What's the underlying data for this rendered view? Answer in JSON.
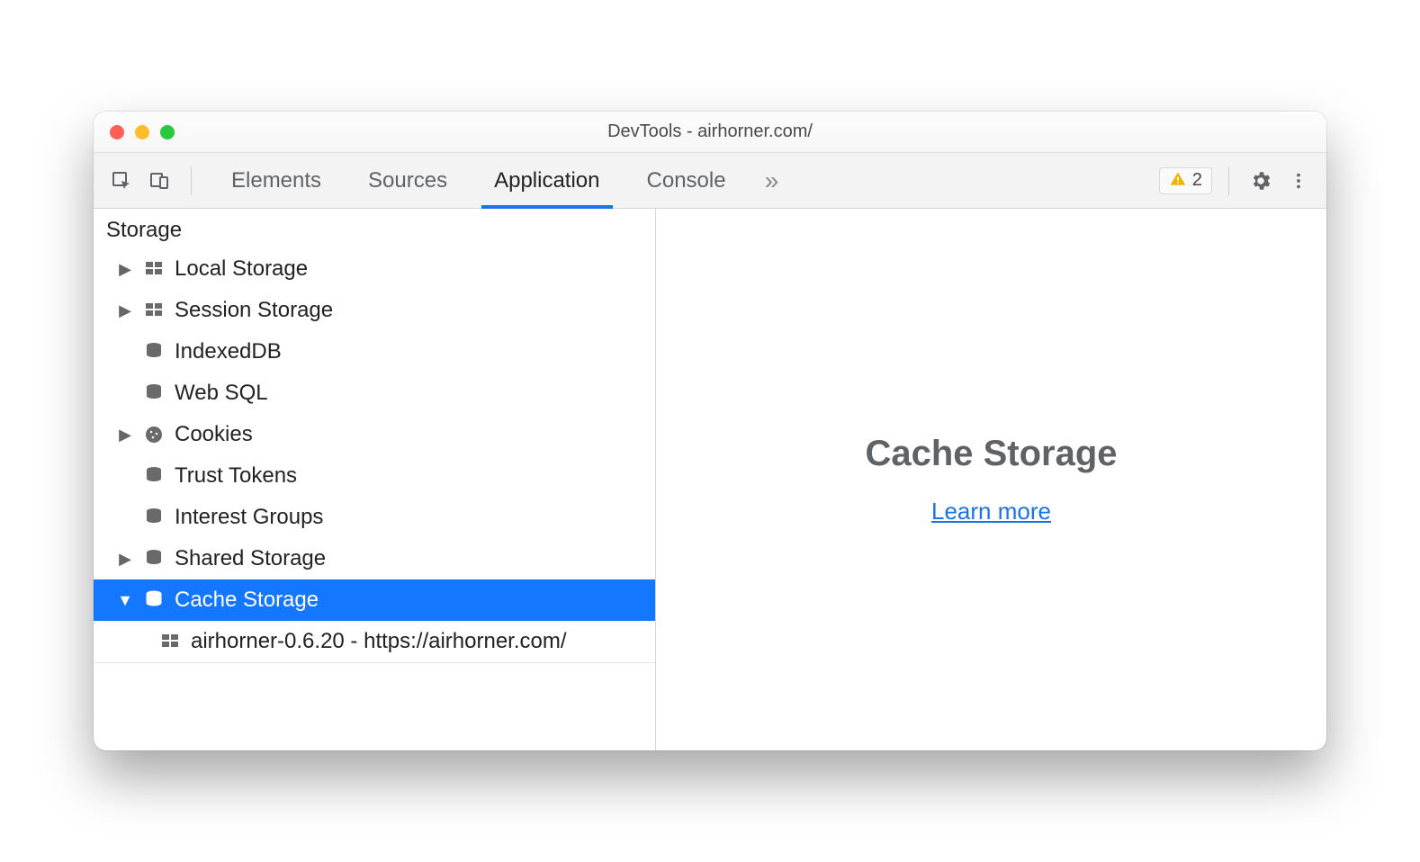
{
  "window": {
    "title": "DevTools - airhorner.com/"
  },
  "toolbar": {
    "tabs": [
      "Elements",
      "Sources",
      "Application",
      "Console"
    ],
    "active_tab_index": 2,
    "issues_count": "2"
  },
  "sidebar": {
    "section": "Storage",
    "items": {
      "local_storage": "Local Storage",
      "session_storage": "Session Storage",
      "indexeddb": "IndexedDB",
      "web_sql": "Web SQL",
      "cookies": "Cookies",
      "trust_tokens": "Trust Tokens",
      "interest_groups": "Interest Groups",
      "shared_storage": "Shared Storage",
      "cache_storage": "Cache Storage",
      "cache_child": "airhorner-0.6.20 - https://airhorner.com/"
    }
  },
  "main": {
    "heading": "Cache Storage",
    "link": "Learn more"
  }
}
